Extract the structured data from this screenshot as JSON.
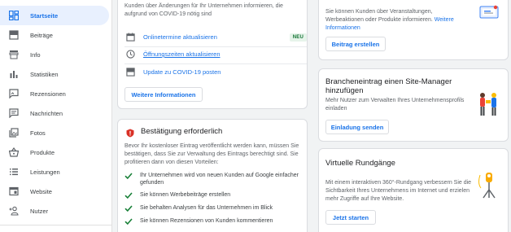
{
  "sidebar": {
    "items": [
      {
        "label": "Startseite",
        "icon": "dashboard-icon",
        "active": true
      },
      {
        "label": "Beiträge",
        "icon": "posts-icon"
      },
      {
        "label": "Info",
        "icon": "storefront-icon"
      },
      {
        "label": "Statistiken",
        "icon": "bar-chart-icon"
      },
      {
        "label": "Rezensionen",
        "icon": "review-icon"
      },
      {
        "label": "Nachrichten",
        "icon": "message-icon"
      },
      {
        "label": "Fotos",
        "icon": "photos-icon"
      },
      {
        "label": "Produkte",
        "icon": "basket-icon"
      },
      {
        "label": "Leistungen",
        "icon": "list-icon"
      },
      {
        "label": "Website",
        "icon": "website-icon"
      },
      {
        "label": "Nutzer",
        "icon": "add-user-icon"
      }
    ]
  },
  "covid_card": {
    "intro": "Kunden über Änderungen für Ihr Unternehmen informieren, die aufgrund von COVID-19 nötig sind",
    "rows": [
      {
        "label": "Onlinetermine aktualisieren",
        "badge": "NEU",
        "icon": "calendar-icon"
      },
      {
        "label": "Öffnungszeiten aktualisieren",
        "icon": "clock-icon"
      },
      {
        "label": "Update zu COVID-19 posten",
        "icon": "post-icon"
      }
    ],
    "button": "Weitere Informationen"
  },
  "verify_card": {
    "title": "Bestätigung erforderlich",
    "intro": "Bevor Ihr kostenloser Eintrag veröffentlicht werden kann, müssen Sie bestätigen, dass Sie zur Verwaltung des Eintrags berechtigt sind. Sie profitieren dann von diesen Vorteilen:",
    "benefits": [
      "Ihr Unternehmen wird von neuen Kunden auf Google einfacher gefunden",
      "Sie können Werbebeiträge erstellen",
      "Sie behalten Analysen für das Unternehmen im Blick",
      "Sie können Rezensionen von Kunden kommentieren"
    ]
  },
  "post_card": {
    "text": "Sie können Kunden über Veranstaltungen, Werbeaktionen oder Produkte informieren.",
    "link": "Weitere Informationen",
    "button": "Beitrag erstellen"
  },
  "manager_card": {
    "title": "Brancheneintrag einen Site-Manager hinzufügen",
    "text": "Mehr Nutzer zum Verwalten Ihres Unternehmensprofils einladen",
    "button": "Einladung senden"
  },
  "tour_card": {
    "title": "Virtuelle Rundgänge",
    "text": "Mit einem interaktiven 360°-Rundgang verbessern Sie die Sichtbarkeit Ihres Unternehmens im Internet und erzielen mehr Zugriffe auf Ihre Website.",
    "button": "Jetzt starten"
  },
  "colors": {
    "accent": "#1a73e8",
    "alert": "#d93025",
    "check": "#188038",
    "badge_bg": "#e6f4ea"
  }
}
